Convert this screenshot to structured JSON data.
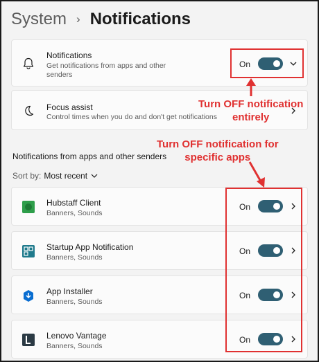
{
  "breadcrumb": {
    "parent": "System",
    "separator": "›",
    "current": "Notifications"
  },
  "main_card": {
    "title": "Notifications",
    "subtitle_line1": "Get notifications from apps and other",
    "subtitle_line2": "senders",
    "state": "On",
    "icon": "bell-icon"
  },
  "focus_card": {
    "title": "Focus assist",
    "subtitle": "Control times when you do and don't get notifications",
    "icon": "moon-icon"
  },
  "section": {
    "title": "Notifications from apps and other senders",
    "sort_label": "Sort by:",
    "sort_value": "Most recent"
  },
  "apps": [
    {
      "name": "Hubstaff Client",
      "detail": "Banners, Sounds",
      "state": "On",
      "icon": "hubstaff-icon"
    },
    {
      "name": "Startup App Notification",
      "detail": "Banners, Sounds",
      "state": "On",
      "icon": "startup-app-icon"
    },
    {
      "name": "App Installer",
      "detail": "Banners, Sounds",
      "state": "On",
      "icon": "app-installer-icon"
    },
    {
      "name": "Lenovo Vantage",
      "detail": "Banners, Sounds",
      "state": "On",
      "icon": "lenovo-vantage-icon"
    }
  ],
  "annotations": {
    "top_line1": "Turn OFF notification",
    "top_line2": "entirely",
    "apps_line1": "Turn OFF notification for",
    "apps_line2": "specific apps"
  },
  "colors": {
    "toggle_on": "#2f5f73",
    "annotation_red": "#e03131",
    "hubstaff_green": "#2e9e4a",
    "startup_teal": "#1f7a8c",
    "installer_blue": "#0a6ed1",
    "lenovo_dark": "#2b3a44"
  }
}
